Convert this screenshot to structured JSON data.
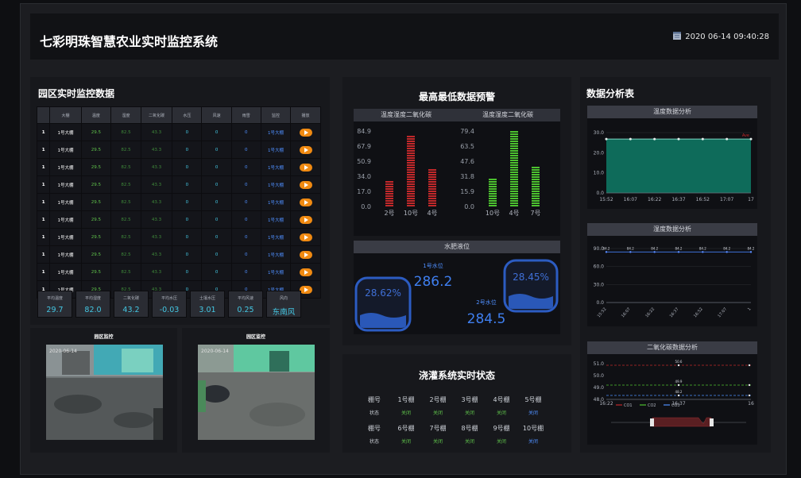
{
  "header": {
    "title": "七彩明珠智慧农业实时监控系统",
    "datetime": "2020 06-14 09:40:28"
  },
  "monitor": {
    "title": "园区实时监控数据",
    "columns": [
      "",
      "大棚",
      "温度",
      "湿度",
      "二氧化碳",
      "水压",
      "风速",
      "雨雪",
      "监控",
      "播放"
    ],
    "rows": [
      [
        "1",
        "1号大棚",
        "29.5",
        "82.5",
        "43.3",
        "0",
        "0",
        "0",
        "1号大棚"
      ],
      [
        "1",
        "1号大棚",
        "29.5",
        "82.5",
        "43.3",
        "0",
        "0",
        "0",
        "1号大棚"
      ],
      [
        "1",
        "1号大棚",
        "29.5",
        "82.5",
        "43.3",
        "0",
        "0",
        "0",
        "1号大棚"
      ],
      [
        "1",
        "1号大棚",
        "29.5",
        "82.5",
        "43.3",
        "0",
        "0",
        "0",
        "1号大棚"
      ],
      [
        "1",
        "1号大棚",
        "29.5",
        "82.5",
        "43.3",
        "0",
        "0",
        "0",
        "1号大棚"
      ],
      [
        "1",
        "1号大棚",
        "29.5",
        "82.5",
        "43.3",
        "0",
        "0",
        "0",
        "1号大棚"
      ],
      [
        "1",
        "1号大棚",
        "29.5",
        "82.5",
        "43.3",
        "0",
        "0",
        "0",
        "1号大棚"
      ],
      [
        "1",
        "1号大棚",
        "29.5",
        "82.5",
        "43.3",
        "0",
        "0",
        "0",
        "1号大棚"
      ],
      [
        "1",
        "1号大棚",
        "29.5",
        "82.5",
        "43.3",
        "0",
        "0",
        "0",
        "1号大棚"
      ],
      [
        "1",
        "1号大棚",
        "29.5",
        "82.5",
        "43.3",
        "0",
        "0",
        "0",
        "1号大棚"
      ]
    ],
    "stats": [
      {
        "label": "平均温度",
        "value": "29.7"
      },
      {
        "label": "平均湿度",
        "value": "82.0"
      },
      {
        "label": "二氧化碳",
        "value": "43.2"
      },
      {
        "label": "平均水压",
        "value": "-0.03"
      },
      {
        "label": "土壤水压",
        "value": "3.01"
      },
      {
        "label": "平均风速",
        "value": "0.25"
      },
      {
        "label": "风向",
        "value": "东南风"
      }
    ]
  },
  "cameras": [
    {
      "title": "园区监控",
      "timestamp": "2020-06-14"
    },
    {
      "title": "园区监控",
      "timestamp": "2020-06-14"
    }
  ],
  "alerts": {
    "title": "最高最低数据预警",
    "charts": [
      {
        "subtitle": "温度湿度二氧化碳",
        "ticks": [
          "84.9",
          "67.9",
          "50.9",
          "34.0",
          "17.0",
          "0.0"
        ],
        "max": 84.9,
        "color": "#c0282a",
        "categories": [
          "2号",
          "10号",
          "4号"
        ],
        "values": [
          28,
          78,
          42
        ]
      },
      {
        "subtitle": "温度湿度二氧化碳",
        "ticks": [
          "79.4",
          "63.5",
          "47.6",
          "31.8",
          "15.9",
          "0.0"
        ],
        "max": 79.4,
        "color": "#4cc12f",
        "categories": [
          "10号",
          "4号",
          "7号"
        ],
        "values": [
          30,
          80,
          42
        ]
      }
    ]
  },
  "water": {
    "title": "水肥液位",
    "tanks": [
      {
        "percent": "28.62%",
        "label": "1号水位",
        "value": "286.2",
        "fill": 0.2862
      },
      {
        "percent": "28.45%",
        "label": "2号水位",
        "value": "284.5",
        "fill": 0.2845
      }
    ]
  },
  "irrigation": {
    "title": "浇灌系统实时状态",
    "row_labels": [
      "棚号",
      "状态"
    ],
    "groups": [
      {
        "sheds": [
          "1号棚",
          "2号棚",
          "3号棚",
          "4号棚",
          "5号棚"
        ],
        "status": [
          "关闭",
          "关闭",
          "关闭",
          "关闭",
          "关闭"
        ],
        "status_color": [
          "g",
          "g",
          "g",
          "g",
          "b"
        ]
      },
      {
        "sheds": [
          "6号棚",
          "7号棚",
          "8号棚",
          "9号棚",
          "10号棚"
        ],
        "status": [
          "关闭",
          "关闭",
          "关闭",
          "关闭",
          "关闭"
        ],
        "status_color": [
          "g",
          "g",
          "g",
          "g",
          "b"
        ]
      }
    ]
  },
  "analysis": {
    "title": "数据分析表",
    "temp": {
      "subtitle": "温度数据分析",
      "yticks": [
        "30.0",
        "20.0",
        "10.0",
        "0.0"
      ],
      "xticks": [
        "15:52",
        "16:07",
        "16:22",
        "16:37",
        "16:52",
        "17:07",
        "17"
      ],
      "legend": "Ave",
      "values": [
        26.8,
        26.8,
        26.8,
        26.8,
        26.8,
        26.8,
        26.8
      ]
    },
    "hum": {
      "subtitle": "湿度数据分析",
      "yticks": [
        "90.0",
        "60.0",
        "30.0",
        "0.0"
      ],
      "xticks": [
        "15:52",
        "16:07",
        "16:22",
        "16:37",
        "16:52",
        "17:07",
        "1"
      ],
      "point_labels": [
        "84.2",
        "84.2",
        "84.2",
        "84.2",
        "84.2",
        "84.2",
        "84.2"
      ],
      "values": [
        84.2,
        84.2,
        84.2,
        84.2,
        84.2,
        84.2,
        84.2
      ]
    },
    "co2": {
      "subtitle": "二氧化碳数据分析",
      "yticks": [
        "51.0",
        "50.0",
        "49.0",
        "48.0"
      ],
      "xticks": [
        "16:22",
        "16:37",
        "16"
      ],
      "legend": [
        "CO1",
        "CO2",
        "CO3"
      ],
      "legend_colors": [
        "#c0282a",
        "#4cc12f",
        "#4f8fff"
      ],
      "point_labels": [
        "50.6",
        "49.9",
        "48.2"
      ]
    }
  }
}
